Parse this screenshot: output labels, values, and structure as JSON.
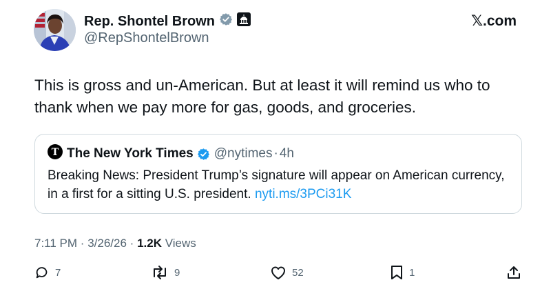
{
  "author": {
    "name": "Rep. Shontel Brown",
    "handle": "@RepShontelBrown"
  },
  "site_label": "𝕏.com",
  "tweet_text": "This is gross and un-American. But at least it will remind us who to thank when we pay more for gas, goods, and groceries.",
  "quote": {
    "name": "The New York Times",
    "handle": "@nytimes",
    "separator": "·",
    "age": "4h",
    "text": "Breaking News: President Trump’s signature will appear on American currency, in a first for a sitting U.S. president.",
    "link": "nyti.ms/3PCi31K"
  },
  "meta": {
    "time": "7:11 PM",
    "separator": "·",
    "date": "3/26/26",
    "separator2": "·",
    "views_count": "1.2K",
    "views_label": "Views"
  },
  "actions": {
    "replies": "7",
    "reposts": "9",
    "likes": "52",
    "bookmarks": "1"
  },
  "colors": {
    "verified_badge": "#829aab",
    "nyt_verified_badge": "#1d9bf0",
    "link": "#1d9bf0",
    "secondary_text": "#536471"
  },
  "icons": [
    "verified-badge-icon",
    "capitol-icon",
    "nyt-logo-icon",
    "reply-icon",
    "repost-icon",
    "like-icon",
    "bookmark-icon",
    "share-icon"
  ]
}
